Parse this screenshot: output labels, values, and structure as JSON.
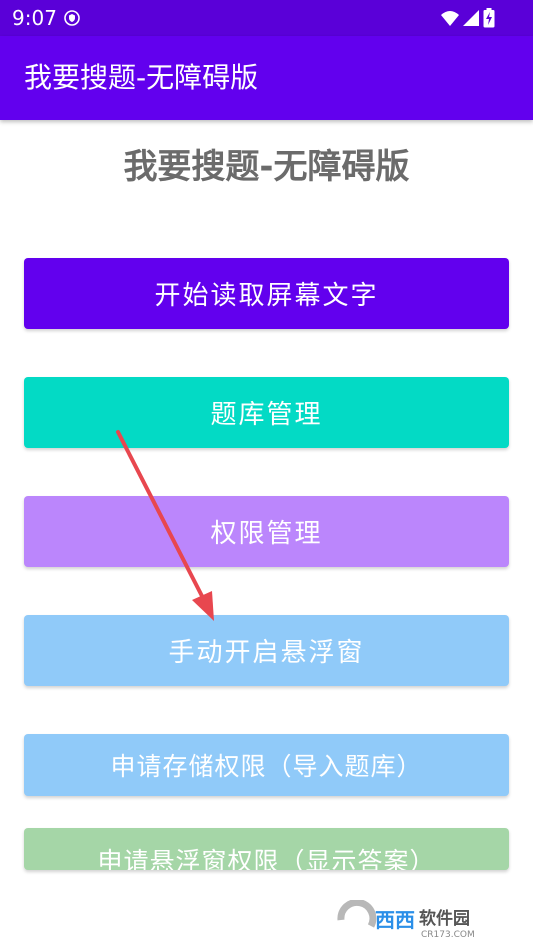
{
  "status_bar": {
    "time": "9:07",
    "icons": [
      "vpn-key-icon",
      "wifi-icon",
      "cellular-signal-icon",
      "battery-charging-icon"
    ]
  },
  "app_bar": {
    "title": "我要搜题-无障碍版"
  },
  "main": {
    "page_title": "我要搜题-无障碍版",
    "buttons": [
      {
        "label": "开始读取屏幕文字",
        "color": "#6200ee"
      },
      {
        "label": "题库管理",
        "color": "#03dac5"
      },
      {
        "label": "权限管理",
        "color": "#bb86fc"
      },
      {
        "label": "手动开启悬浮窗",
        "color": "#90caf9"
      },
      {
        "label": "申请存储权限（导入题库）",
        "color": "#90caf9"
      },
      {
        "label": "申请悬浮窗权限（显示答案）",
        "color": "#a5d6a7"
      }
    ]
  },
  "annotation": {
    "arrow_color": "#e8474f"
  },
  "watermark": {
    "text": "西西软件园",
    "sub": "CR173.COM"
  },
  "colors": {
    "primary": "#6200ee",
    "primary_dark": "#5a00d8"
  }
}
